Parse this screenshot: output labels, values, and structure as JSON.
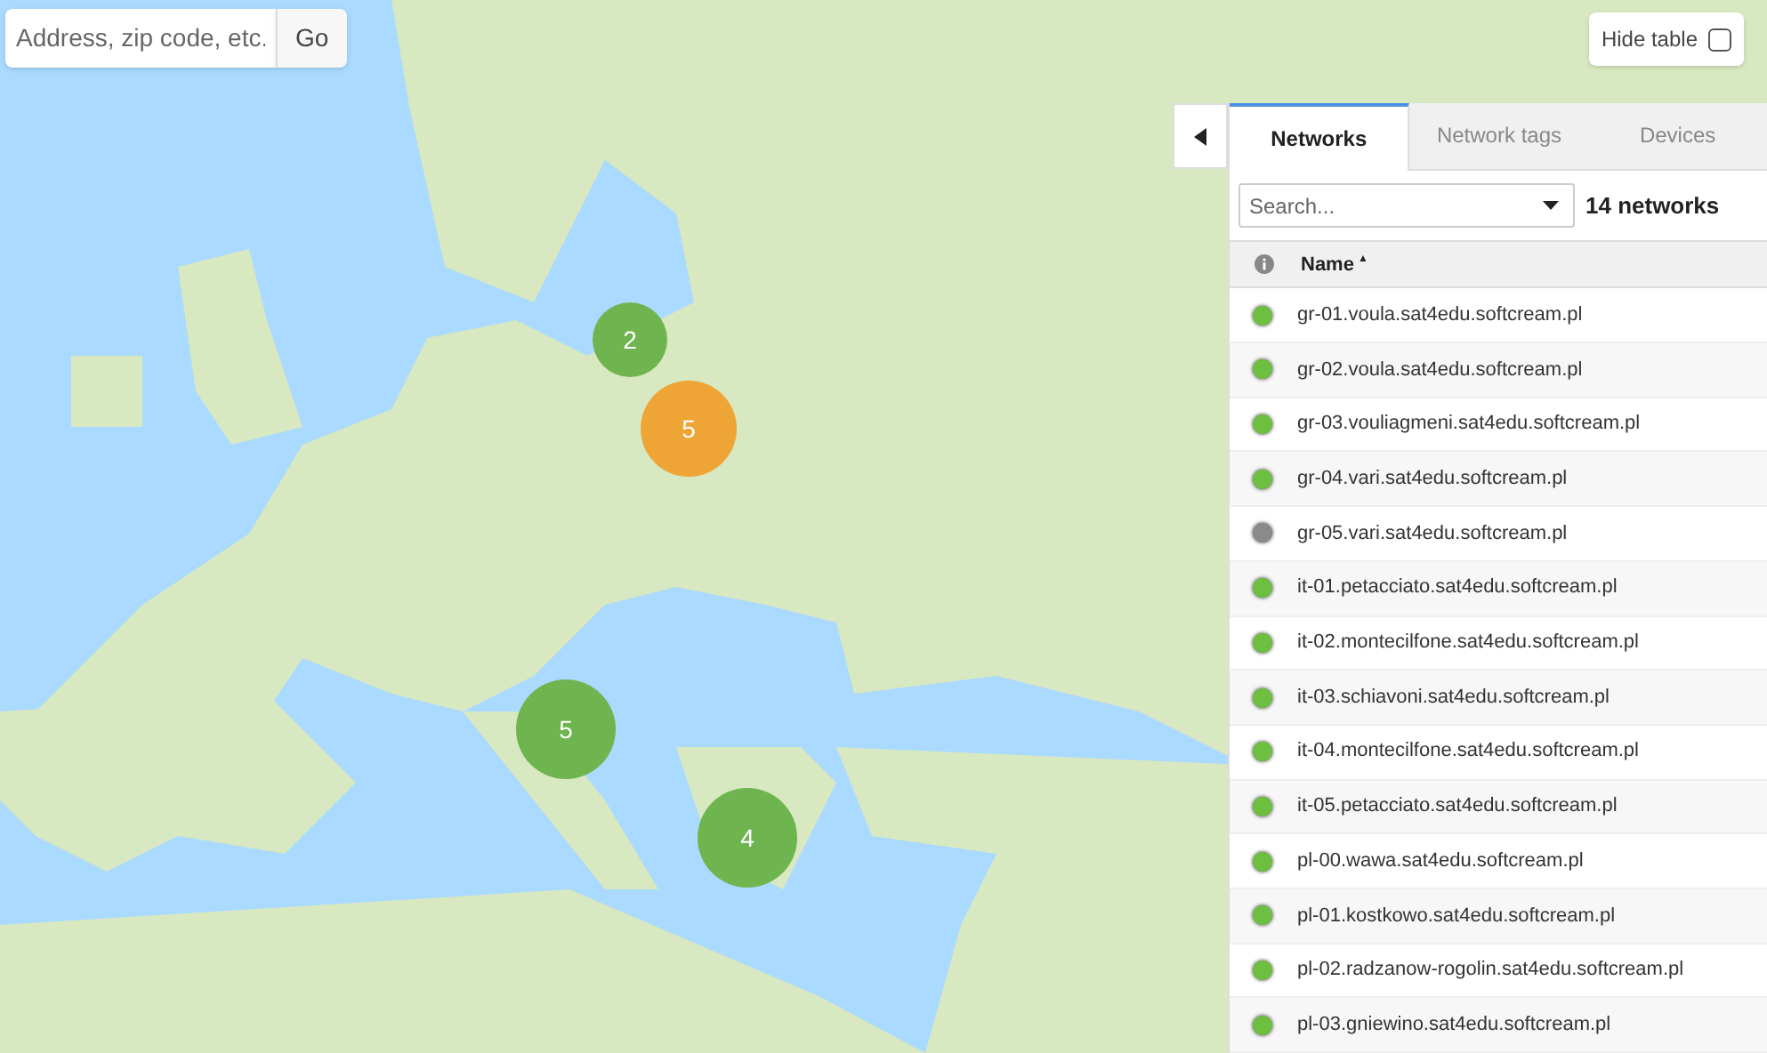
{
  "address_search": {
    "placeholder": "Address, zip code, etc.",
    "button": "Go"
  },
  "hide_table": {
    "label": "Hide table",
    "checked": false
  },
  "clusters": [
    {
      "count": "2",
      "color": "#6fb54f"
    },
    {
      "count": "5",
      "color": "#eea536"
    },
    {
      "count": "5",
      "color": "#6fb54f"
    },
    {
      "count": "4",
      "color": "#6fb54f"
    }
  ],
  "panel": {
    "tabs": [
      {
        "label": "Networks",
        "selected": true
      },
      {
        "label": "Network tags",
        "selected": false
      },
      {
        "label": "Devices",
        "selected": false
      }
    ],
    "search": {
      "placeholder": "Search..."
    },
    "count": "14 networks",
    "columns": [
      "Name"
    ],
    "sort_indicator": "▲",
    "rows": [
      {
        "name": "gr-01.voula.sat4edu.softcream.pl",
        "color": "#6cbf3f"
      },
      {
        "name": "gr-02.voula.sat4edu.softcream.pl",
        "color": "#6cbf3f"
      },
      {
        "name": "gr-03.vouliagmeni.sat4edu.softcream.pl",
        "color": "#6cbf3f"
      },
      {
        "name": "gr-04.vari.sat4edu.softcream.pl",
        "color": "#6cbf3f"
      },
      {
        "name": "gr-05.vari.sat4edu.softcream.pl",
        "color": "#8a8a8a"
      },
      {
        "name": "it-01.petacciato.sat4edu.softcream.pl",
        "color": "#6cbf3f"
      },
      {
        "name": "it-02.montecilfone.sat4edu.softcream.pl",
        "color": "#6cbf3f"
      },
      {
        "name": "it-03.schiavoni.sat4edu.softcream.pl",
        "color": "#6cbf3f"
      },
      {
        "name": "it-04.montecilfone.sat4edu.softcream.pl",
        "color": "#6cbf3f"
      },
      {
        "name": "it-05.petacciato.sat4edu.softcream.pl",
        "color": "#6cbf3f"
      },
      {
        "name": "pl-00.wawa.sat4edu.softcream.pl",
        "color": "#6cbf3f"
      },
      {
        "name": "pl-01.kostkowo.sat4edu.softcream.pl",
        "color": "#6cbf3f"
      },
      {
        "name": "pl-02.radzanow-rogolin.sat4edu.softcream.pl",
        "color": "#6cbf3f"
      },
      {
        "name": "pl-03.gniewino.sat4edu.softcream.pl",
        "color": "#6cbf3f"
      }
    ]
  }
}
